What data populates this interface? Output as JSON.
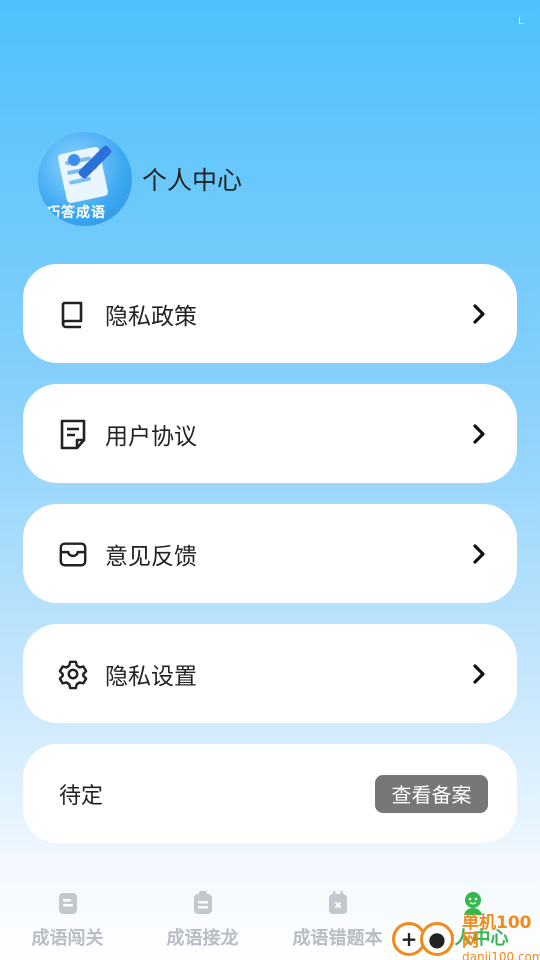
{
  "status": {
    "mark": "L"
  },
  "profile": {
    "avatar_text": "巧答成语",
    "title": "个人中心"
  },
  "menu": [
    {
      "label": "隐私政策",
      "icon": "book-icon"
    },
    {
      "label": "用户协议",
      "icon": "document-icon"
    },
    {
      "label": "意见反馈",
      "icon": "inbox-icon"
    },
    {
      "label": "隐私设置",
      "icon": "gear-icon"
    }
  ],
  "pending": {
    "label": "待定",
    "button": "查看备案"
  },
  "tabs": [
    {
      "label": "成语闯关",
      "icon": "clipboard-icon",
      "active": false
    },
    {
      "label": "成语接龙",
      "icon": "clipboard-icon",
      "active": false
    },
    {
      "label": "成语错题本",
      "icon": "calendar-x-icon",
      "active": false
    },
    {
      "label": "个人中心",
      "icon": "user-icon",
      "active": true
    }
  ],
  "watermark": {
    "cn": "单机100网",
    "en": "danji100.com"
  },
  "colors": {
    "accent": "#33b84e",
    "inactive": "#b8bcc4",
    "button_gray": "#777777",
    "watermark": "#f28a1c"
  }
}
